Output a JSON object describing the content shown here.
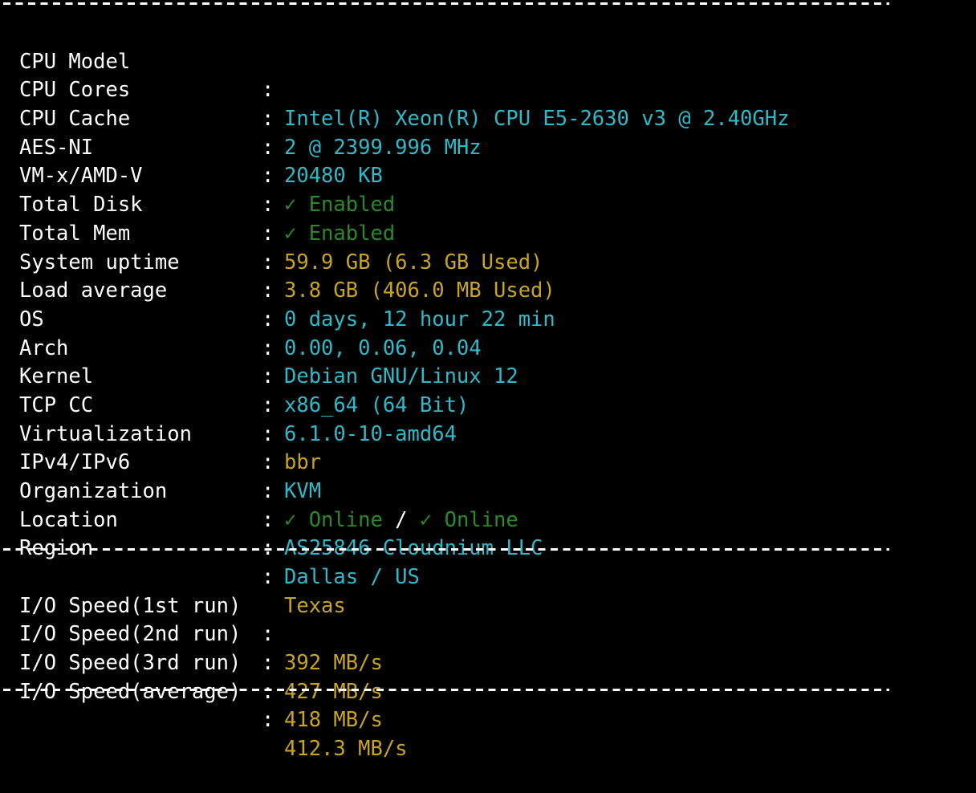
{
  "separator": "------------------------------------------------------------------------",
  "system_info": [
    {
      "label": "CPU Model",
      "value": "Intel(R) Xeon(R) CPU E5-2630 v3 @ 2.40GHz",
      "color": "#2fb9c9"
    },
    {
      "label": "CPU Cores",
      "value": "2 @ 2399.996 MHz",
      "color": "#2fb9c9"
    },
    {
      "label": "CPU Cache",
      "value": "20480 KB",
      "color": "#2fb9c9"
    },
    {
      "label": "AES-NI",
      "value": "✓ Enabled",
      "color": "#2a8a2a"
    },
    {
      "label": "VM-x/AMD-V",
      "value": "✓ Enabled",
      "color": "#2a8a2a"
    },
    {
      "label": "Total Disk",
      "value": "59.9 GB (6.3 GB Used)",
      "color": "#c8a41f"
    },
    {
      "label": "Total Mem",
      "value": "3.8 GB (406.0 MB Used)",
      "color": "#c8a41f"
    },
    {
      "label": "System uptime",
      "value": "0 days, 12 hour 22 min",
      "color": "#2fb9c9"
    },
    {
      "label": "Load average",
      "value": "0.00, 0.06, 0.04",
      "color": "#2fb9c9"
    },
    {
      "label": "OS",
      "value": "Debian GNU/Linux 12",
      "color": "#2fb9c9"
    },
    {
      "label": "Arch",
      "value": "x86_64 (64 Bit)",
      "color": "#2fb9c9"
    },
    {
      "label": "Kernel",
      "value": "6.1.0-10-amd64",
      "color": "#2fb9c9"
    },
    {
      "label": "TCP CC",
      "value": "bbr",
      "color": "#c8a41f"
    },
    {
      "label": "Virtualization",
      "value": "KVM",
      "color": "#2fb9c9"
    },
    {
      "label": "IPv4/IPv6",
      "ipv4": "✓ Online",
      "divider": " / ",
      "ipv6": "✓ Online",
      "color": "#2a8a2a"
    },
    {
      "label": "Organization",
      "value": "AS25846 Cloudnium LLC",
      "color": "#2fb9c9"
    },
    {
      "label": "Location",
      "value": "Dallas / US",
      "color": "#2fb9c9"
    },
    {
      "label": "Region",
      "value": "Texas",
      "color": "#c8a41f"
    }
  ],
  "io_speed": [
    {
      "label": "I/O Speed(1st run)",
      "value": "392 MB/s",
      "color": "#c8a41f"
    },
    {
      "label": "I/O Speed(2nd run)",
      "value": "427 MB/s",
      "color": "#c8a41f"
    },
    {
      "label": "I/O Speed(3rd run)",
      "value": "418 MB/s",
      "color": "#c8a41f"
    },
    {
      "label": "I/O Speed(average)",
      "value": "412.3 MB/s",
      "color": "#c8a41f"
    }
  ],
  "colon": ":"
}
